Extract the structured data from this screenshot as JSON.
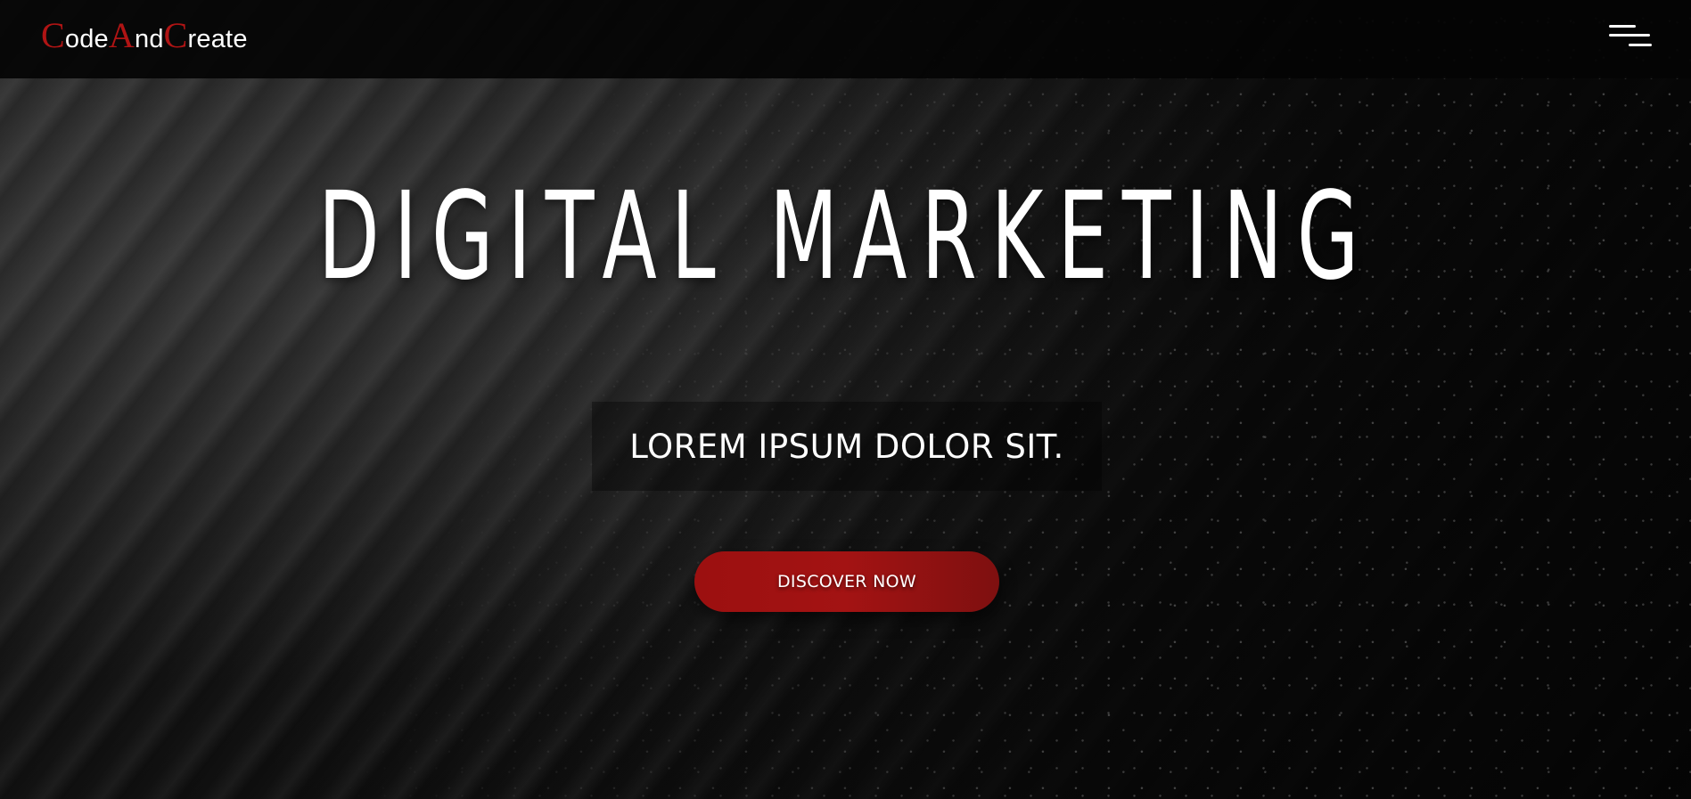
{
  "header": {
    "logo": {
      "part1_cap": "C",
      "part1_rest": "ode",
      "part2_cap": "A",
      "part2_rest": "nd",
      "part3_cap": "C",
      "part3_rest": "reate"
    },
    "menu_icon": "hamburger-menu-icon"
  },
  "hero": {
    "title": "DIGITAL MARKETING",
    "subtitle": "LOREM IPSUM DOLOR SIT.",
    "cta_label": "DISCOVER NOW"
  },
  "colors": {
    "accent": "#a31313",
    "text": "#ffffff",
    "background": "#0a0a0a"
  }
}
